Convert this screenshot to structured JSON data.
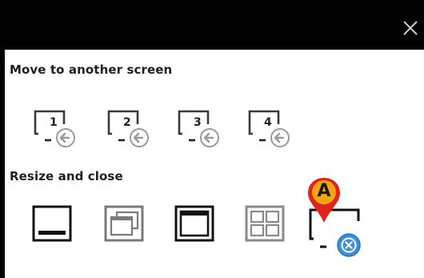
{
  "window": {
    "close_icon": "close-icon",
    "background": "#ffffff",
    "titlebar_color": "#000000"
  },
  "move_section": {
    "title": "Move to another screen",
    "screens": [
      {
        "number": "1",
        "icon": "move-to-screen-icon"
      },
      {
        "number": "2",
        "icon": "move-to-screen-icon"
      },
      {
        "number": "3",
        "icon": "move-to-screen-icon"
      },
      {
        "number": "4",
        "icon": "move-to-screen-icon"
      }
    ]
  },
  "resize_section": {
    "title": "Resize and close",
    "buttons": [
      {
        "icon": "minimize-icon"
      },
      {
        "icon": "restore-icon"
      },
      {
        "icon": "maximize-icon"
      },
      {
        "icon": "tile-icon"
      },
      {
        "icon": "close-window-icon"
      }
    ]
  },
  "callout": {
    "letter": "A",
    "color": "#f3a513",
    "border": "#e2231a"
  },
  "colors": {
    "accent_blue": "#3b8fd9",
    "arrow_gray": "#9a9a9a"
  }
}
